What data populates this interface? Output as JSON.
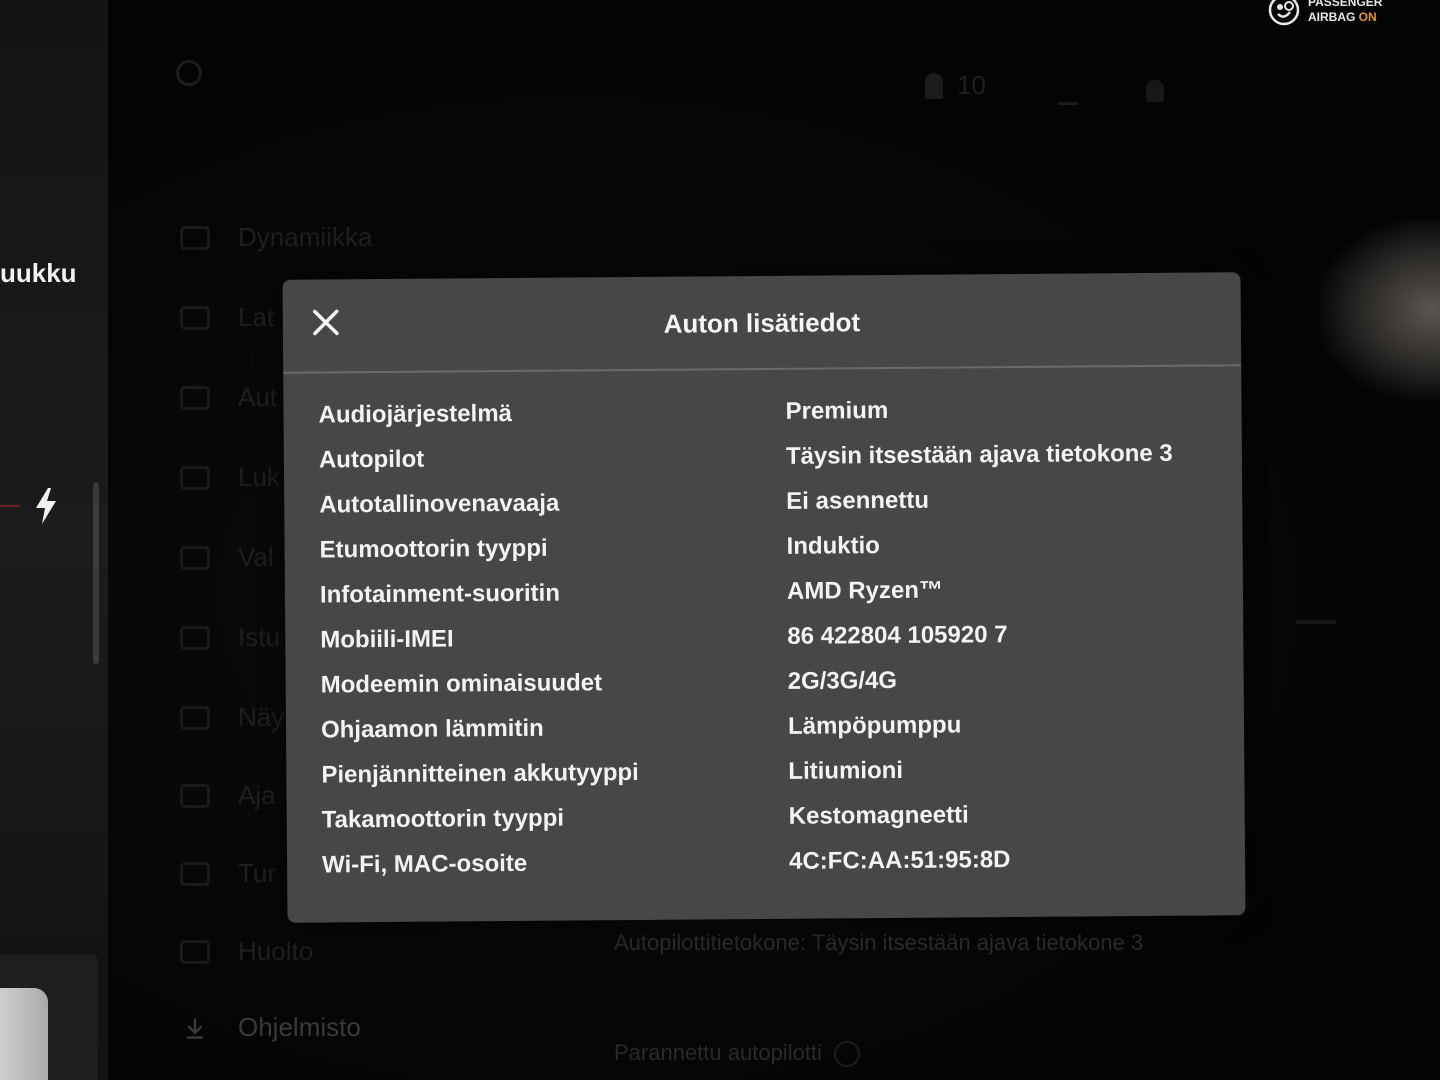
{
  "status": {
    "airbag_line1": "PASSENGER",
    "airbag_line2_prefix": "AIRBAG ",
    "airbag_line2_state": "ON",
    "on_color": "#e8912a"
  },
  "left_panel": {
    "title": "uukku",
    "icon": "lightning-bolt-icon"
  },
  "settings_bg": {
    "profile_count": "10",
    "menu": [
      {
        "label": "Dynamiikka",
        "icon": "car-icon"
      },
      {
        "label": "Lat",
        "icon": "charging-icon"
      },
      {
        "label": "Aut",
        "icon": "steering-wheel-icon"
      },
      {
        "label": "Luk",
        "icon": "lock-icon"
      },
      {
        "label": "Val",
        "icon": "light-icon"
      },
      {
        "label": "Istu",
        "icon": "seat-icon"
      },
      {
        "label": "Näy",
        "icon": "display-icon"
      },
      {
        "label": "Aja",
        "icon": "trip-icon"
      },
      {
        "label": "Tur",
        "icon": "shield-icon"
      },
      {
        "label": "Huolto",
        "icon": "wrench-icon"
      },
      {
        "label": "Ohjelmisto",
        "icon": "download-icon"
      }
    ],
    "autopilot_computer": "Autopilottitietokone: Täysin itsestään ajava tietokone 3",
    "enhanced_autopilot": "Parannettu autopilotti"
  },
  "modal": {
    "title": "Auton lisätiedot",
    "close_icon": "close-icon",
    "rows": [
      {
        "label": "Audiojärjestelmä",
        "value": "Premium"
      },
      {
        "label": "Autopilot",
        "value": "Täysin itsestään ajava tietokone 3"
      },
      {
        "label": "Autotallinovenavaaja",
        "value": "Ei asennettu"
      },
      {
        "label": "Etumoottorin tyyppi",
        "value": "Induktio"
      },
      {
        "label": "Infotainment-suoritin",
        "value": "AMD Ryzen™"
      },
      {
        "label": "Mobiili-IMEI",
        "value": "86 422804 105920 7"
      },
      {
        "label": "Modeemin ominaisuudet",
        "value": "2G/3G/4G"
      },
      {
        "label": "Ohjaamon lämmitin",
        "value": "Lämpöpumppu"
      },
      {
        "label": "Pienjännitteinen akkutyyppi",
        "value": "Litiumioni"
      },
      {
        "label": "Takamoottorin tyyppi",
        "value": "Kestomagneetti"
      },
      {
        "label": "Wi-Fi, MAC-osoite",
        "value": "4C:FC:AA:51:95:8D"
      }
    ]
  }
}
